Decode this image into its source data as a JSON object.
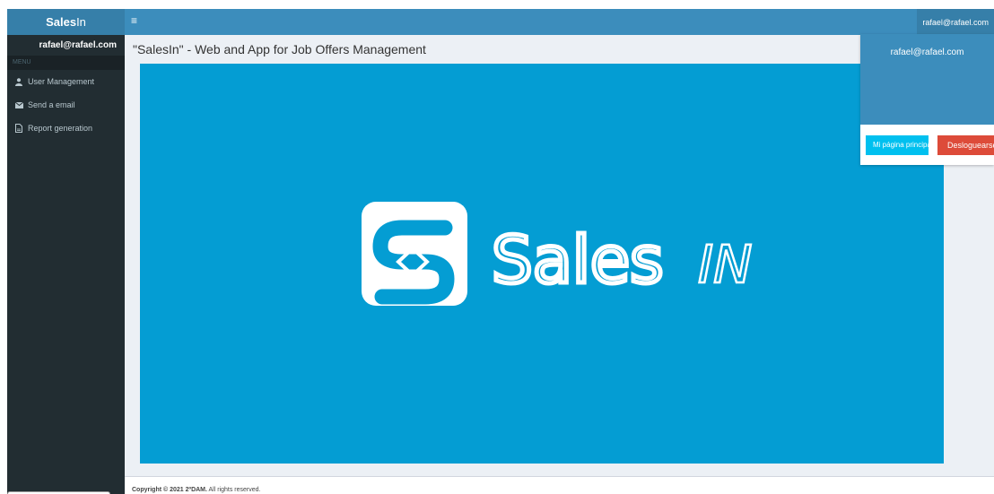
{
  "header": {
    "logo_bold": "Sales",
    "logo_light": "In",
    "menu_toggle": "≡",
    "user_email": "rafael@rafael.com"
  },
  "sidebar": {
    "user": "rafael@rafael.com",
    "section_header": "MENU",
    "items": [
      {
        "label": "User Management",
        "icon": "user-icon"
      },
      {
        "label": "Send a email",
        "icon": "envelope-icon"
      },
      {
        "label": "Report generation",
        "icon": "file-icon"
      }
    ]
  },
  "main": {
    "title": "\"SalesIn\" - Web and App for Job Offers Management",
    "banner": {
      "brand_text": "Sales",
      "brand_suffix": "IN",
      "background": "#049dd3"
    }
  },
  "footer": {
    "copyright_bold": "Copyright © 2021 2ºDAM.",
    "copyright_rest": " All rights reserved."
  },
  "user_dropdown": {
    "email": "rafael@rafael.com",
    "home_button": "Mi página principal",
    "logout_button": "Desloguearse"
  },
  "colors": {
    "navbar": "#3c8dbc",
    "sidebar": "#222d32",
    "info": "#00c0ef",
    "danger": "#dd4b39"
  }
}
